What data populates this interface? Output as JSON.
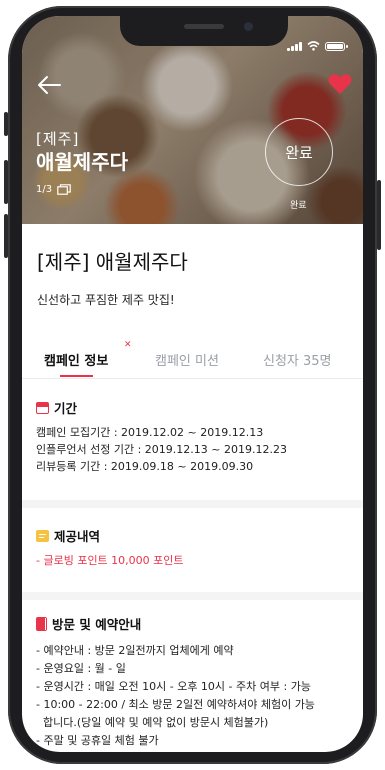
{
  "status_bar": {
    "signal_icon": "signal-icon",
    "wifi_icon": "wifi-icon",
    "battery_icon": "battery-icon"
  },
  "hero": {
    "back_icon": "arrow-left-icon",
    "favorite_icon": "heart-icon",
    "favorite_color": "#e8334a",
    "category": "[제주]",
    "name": "애월제주다",
    "image_counter": "1/3",
    "done_badge": "완료",
    "done_label": "완료"
  },
  "campaign": {
    "title": "[제주] 애월제주다",
    "subtitle": "신선하고 푸짐한 제주 맛집!"
  },
  "tabs": [
    {
      "label": "캠페인 정보",
      "active": true
    },
    {
      "label": "캠페인 미션",
      "active": false
    },
    {
      "label": "신청자 35명",
      "active": false
    }
  ],
  "sections": {
    "period": {
      "icon": "calendar-icon",
      "title": "기간",
      "lines": [
        "캠페인 모집기간 : 2019.12.02 ~ 2019.12.13",
        "인플루언서 선정 기간 : 2019.12.13 ~ 2019.12.23",
        "리뷰등록 기간 : 2019.09.18 ~ 2019.09.30"
      ]
    },
    "provided": {
      "icon": "memo-icon",
      "title": "제공내역",
      "lines": [
        "- 글로빙 포인트 10,000 포인트"
      ]
    },
    "visit": {
      "icon": "book-icon",
      "title": "방문 및 예약안내",
      "lines": [
        "- 예약안내 : 방문 2일전까지 업체에게 예약",
        "- 운영요일 : 월 - 일",
        "- 운영시간 : 매일 오전 10시 - 오후 10시 - 주차 여부 : 가능",
        "- 10:00 - 22:00 / 최소 방문 2일전 예약하셔야 체험이 가능",
        "  합니다.(당일 예약 및 예약 없이 방문시 체험불가)",
        "- 주말 및 공휴일 체험 불가"
      ]
    }
  },
  "colors": {
    "accent": "#e8334a"
  }
}
